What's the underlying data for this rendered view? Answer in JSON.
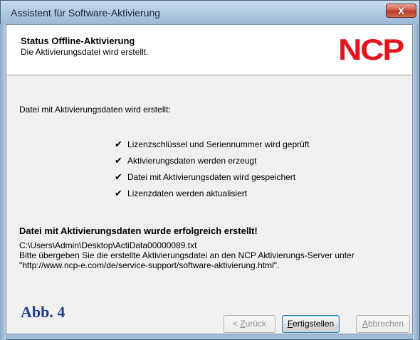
{
  "window": {
    "title": "Assistent für Software-Aktivierung",
    "close_label": "X"
  },
  "header": {
    "title": "Status Offline-Aktivierung",
    "subtitle": "Die Aktivierungsdatei wird erstellt.",
    "logo": "NCP",
    "logo_color": "#e3141b"
  },
  "main": {
    "intro": "Datei mit Aktivierungsdaten wird erstellt:",
    "checkmark": "✔",
    "checklist": [
      "Lizenzschlüssel und Seriennummer wird geprüft",
      "Aktivierungsdaten werden erzeugt",
      "Datei mit Aktivierungsdaten wird gespeichert",
      "Lizenzdaten werden aktualisiert"
    ],
    "success": "Datei mit Aktivierungsdaten wurde erfolgreich erstellt!",
    "file_path": "C:\\Users\\Admin\\Desktop\\ActiData00000089.txt",
    "instruction_line1": "Bitte übergeben Sie die erstellte Aktivierungsdatei an den NCP Aktivierungs-Server unter",
    "instruction_line2": "\"http://www.ncp-e.com/de/service-support/software-aktivierung.html\"."
  },
  "figure_label": "Abb. 4",
  "buttons": {
    "back_prefix": "< ",
    "back_underlined": "Z",
    "back_rest": "urück",
    "finish_underlined": "F",
    "finish_rest": "ertigstellen",
    "cancel_underlined": "A",
    "cancel_rest": "bbrechen"
  }
}
